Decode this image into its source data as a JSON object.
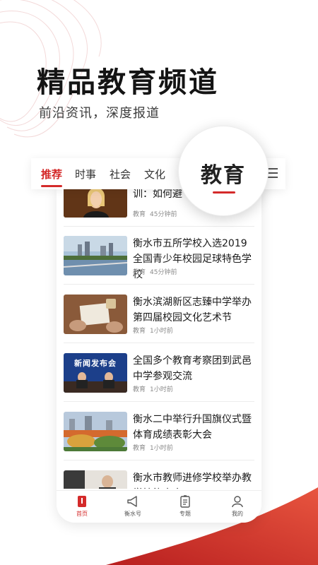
{
  "headline": "精品教育频道",
  "subline": "前沿资讯，深度报道",
  "tabs": [
    {
      "label": "推荐",
      "active": true
    },
    {
      "label": "时事",
      "active": false
    },
    {
      "label": "社会",
      "active": false
    },
    {
      "label": "文化",
      "active": false
    }
  ],
  "bubble_tab": "教育",
  "accent_color": "#d42a2a",
  "news": [
    {
      "title": "训：如何避",
      "tag": "教育",
      "time": "45分钟前"
    },
    {
      "title": "衡水市五所学校入选2019全国青少年校园足球特色学校",
      "tag": "教育",
      "time": "45分钟前"
    },
    {
      "title": "衡水滨湖新区志臻中学举办第四届校园文化艺术节",
      "tag": "教育",
      "time": "1小时前"
    },
    {
      "title": "全国多个教育考察团到武邑中学参观交流",
      "tag": "教育",
      "time": "1小时前",
      "thumb_text": "新闻发布会"
    },
    {
      "title": "衡水二中举行升国旗仪式暨体育成绩表彰大会",
      "tag": "教育",
      "time": "1小时前"
    },
    {
      "title": "衡水市教师进修学校举办教学技能大赛",
      "tag": "",
      "time": ""
    }
  ],
  "bottom_nav": [
    {
      "label": "首页",
      "icon": "home-icon",
      "active": true
    },
    {
      "label": "衡水号",
      "icon": "megaphone-icon",
      "active": false
    },
    {
      "label": "专题",
      "icon": "document-icon",
      "active": false
    },
    {
      "label": "我的",
      "icon": "profile-icon",
      "active": false
    }
  ]
}
